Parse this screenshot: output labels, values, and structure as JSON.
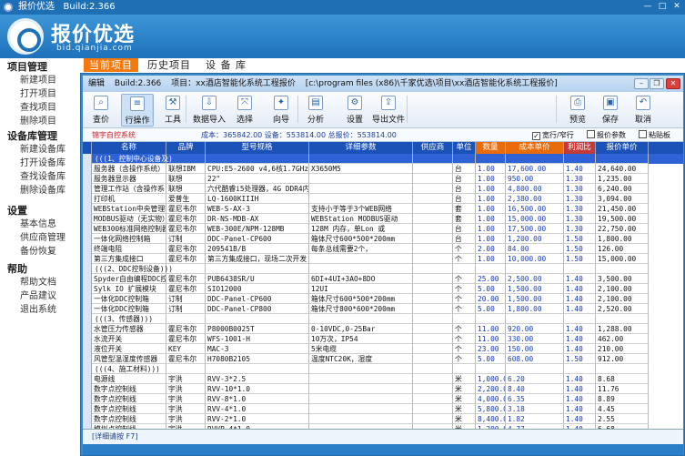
{
  "app": {
    "title": "报价优选",
    "version": "Build:2.366",
    "brand": "报价优选",
    "brand_sub": "bid.qianjia.com"
  },
  "sidebar": [
    {
      "title": "项目管理",
      "items": [
        "新建项目",
        "打开项目",
        "查找项目",
        "删除项目"
      ]
    },
    {
      "title": "设备库管理",
      "items": [
        "新建设备库",
        "打开设备库",
        "查找设备库",
        "删除设备库"
      ]
    },
    {
      "title": "设置",
      "items": [
        "基本信息",
        "供应商管理",
        "备份恢复"
      ]
    },
    {
      "title": "帮助",
      "items": [
        "帮助文档",
        "产品建议",
        "退出系统"
      ]
    }
  ],
  "nav_tabs": [
    "当前项目",
    "历史项目",
    "设 备 库"
  ],
  "window": {
    "menu_edit": "编辑",
    "build": "Build:2.366",
    "project_label": "项目：",
    "project_name": "xx酒店智能化系统工程报价",
    "path": "[c:\\program files (x86)\\千家优选\\项目\\xx酒店智能化系统工程报价]"
  },
  "toolbar": [
    "查价",
    "行操作",
    "工具",
    "数据导入",
    "选择",
    "向导",
    "分析",
    "设置",
    "导出文件",
    "预览",
    "保存",
    "取消"
  ],
  "toolbar_icons": [
    "search-icon",
    "row-icon",
    "tool-icon",
    "import-icon",
    "select-icon",
    "wizard-icon",
    "chart-icon",
    "gear-icon",
    "export-icon",
    "preview-icon",
    "save-icon",
    "cancel-icon"
  ],
  "infobar": {
    "customer": "锦宇自控系统",
    "totals": "成本：365842.00  设备：553814.00  总报价：553814.00",
    "opt_no_tax": "宽行/窄行",
    "opt_params": "报价参数",
    "opt_paste": "粘贴板"
  },
  "grid": {
    "headers": [
      "名称",
      "品牌",
      "型号规格",
      "详细参数",
      "供应商",
      "单位",
      "数量",
      "成本单价",
      "利润比",
      "报价单价"
    ],
    "rows": [
      {
        "g": "(((1、控制中心设备及)",
        "sel": true
      },
      {
        "c": [
          "服务器（含操作系统）",
          "联想IBM",
          "CPU:E5-2600 v4,6核1.7GHz，内存",
          "X3650M5",
          "",
          "台",
          "1.00",
          "17,600.00",
          "1.40",
          "24,640.00"
        ]
      },
      {
        "c": [
          "服务器显示器",
          "联想",
          "22\"",
          "",
          "",
          "台",
          "1.00",
          "950.00",
          "1.30",
          "1,235.00"
        ]
      },
      {
        "c": [
          "管理工作站（含操作系",
          "联想",
          "六代酷睿i5处理器，4G DDR4内存，1T",
          "",
          "",
          "台",
          "1.00",
          "4,800.00",
          "1.30",
          "6,240.00"
        ]
      },
      {
        "c": [
          "打印机",
          "爱普生",
          "LQ-1600KIIIH",
          "",
          "",
          "台",
          "1.00",
          "2,380.00",
          "1.30",
          "3,094.00"
        ]
      },
      {
        "c": [
          "WEBStation中央管理软件",
          "霍尼韦尔",
          "WEB-S-AX-3",
          "支持小于等于3个WEB网络",
          "",
          "套",
          "1.00",
          "16,500.00",
          "1.30",
          "21,450.00"
        ]
      },
      {
        "c": [
          "MODBUS驱动（无实物）",
          "霍尼韦尔",
          "DR-NS-MDB-AX",
          "WEBStation MODBUS驱动",
          "",
          "套",
          "1.00",
          "15,000.00",
          "1.30",
          "19,500.00"
        ]
      },
      {
        "c": [
          "WEB300标准网络控制器",
          "霍尼韦尔",
          "WEB-300E/NPM-128MB",
          "128M 内存，单Lon 或",
          "",
          "台",
          "1.00",
          "17,500.00",
          "1.30",
          "22,750.00"
        ]
      },
      {
        "c": [
          "一体化网络控制箱",
          "订制",
          "DDC-Panel-CP600",
          "箱体尺寸600*500*200mm",
          "",
          "台",
          "1.00",
          "1,200.00",
          "1.50",
          "1,800.00"
        ]
      },
      {
        "c": [
          "终端电阻",
          "霍尼韦尔",
          "209541B/B",
          "每条总线需要2个，",
          "",
          "个",
          "2.00",
          "84.00",
          "1.50",
          "126.00"
        ]
      },
      {
        "c": [
          "第三方集成接口",
          "霍尼韦尔",
          "第三方集成接口，现场二次开发",
          "",
          "",
          "个",
          "1.00",
          "10,000.00",
          "1.50",
          "15,000.00"
        ]
      },
      {
        "g": "(((2、DDC控制设备)))"
      },
      {
        "c": [
          "Spyder自由编程DDC控",
          "霍尼韦尔",
          "PUB6438SR/U",
          "6DI+4UI+3AO+8DO",
          "",
          "个",
          "25.00",
          "2,500.00",
          "1.40",
          "3,500.00"
        ]
      },
      {
        "c": [
          "Sylk IO 扩展模块",
          "霍尼韦尔",
          "SIO12000",
          "12UI",
          "",
          "个",
          "5.00",
          "1,500.00",
          "1.40",
          "2,100.00"
        ]
      },
      {
        "c": [
          "一体化DDC控制箱",
          "订制",
          "DDC-Panel-CP600",
          "箱体尺寸600*500*200mm",
          "",
          "个",
          "20.00",
          "1,500.00",
          "1.40",
          "2,100.00"
        ]
      },
      {
        "c": [
          "一体化DDC控制箱",
          "订制",
          "DDC-Panel-CP800",
          "箱体尺寸800*600*200mm",
          "",
          "个",
          "5.00",
          "1,800.00",
          "1.40",
          "2,520.00"
        ]
      },
      {
        "g": "(((3、传感器)))"
      },
      {
        "c": [
          "水管压力传感器",
          "霍尼韦尔",
          "P8000B0025T",
          "0-10VDC,0-25Bar",
          "",
          "个",
          "11.00",
          "920.00",
          "1.40",
          "1,288.00"
        ]
      },
      {
        "c": [
          "水流开关",
          "霍尼韦尔",
          "WFS-1001-H",
          "10万次，IP54",
          "",
          "个",
          "11.00",
          "330.00",
          "1.40",
          "462.00"
        ]
      },
      {
        "c": [
          "液位开关",
          "KEY",
          "MAC-3",
          "5米电缆",
          "",
          "个",
          "23.00",
          "150.00",
          "1.40",
          "210.00"
        ]
      },
      {
        "c": [
          "风管型温湿度传感器",
          "霍尼韦尔",
          "H7080B2105",
          "温度NTC20K，湿度",
          "",
          "个",
          "5.00",
          "608.00",
          "1.50",
          "912.00"
        ]
      },
      {
        "g": "(((4、施工材料)))"
      },
      {
        "c": [
          "电源线",
          "宇洪",
          "RVV-3*2.5",
          "",
          "",
          "米",
          "1,000.00",
          "6.20",
          "1.40",
          "8.68"
        ]
      },
      {
        "c": [
          "数字点控制线",
          "宇洪",
          "RVV-10*1.0",
          "",
          "",
          "米",
          "2,200.00",
          "8.40",
          "1.40",
          "11.76"
        ]
      },
      {
        "c": [
          "数字点控制线",
          "宇洪",
          "RVV-8*1.0",
          "",
          "",
          "米",
          "4,000.00",
          "6.35",
          "1.40",
          "8.89"
        ]
      },
      {
        "c": [
          "数字点控制线",
          "宇洪",
          "RVV-4*1.0",
          "",
          "",
          "米",
          "5,800.00",
          "3.18",
          "1.40",
          "4.45"
        ]
      },
      {
        "c": [
          "数字点控制线",
          "宇洪",
          "RVV-2*1.0",
          "",
          "",
          "米",
          "8,400.00",
          "1.82",
          "1.40",
          "2.55"
        ]
      },
      {
        "c": [
          "模拟点控制线",
          "宇洪",
          "RVVP-4*1.0",
          "",
          "",
          "米",
          "1,200.00",
          "4.77",
          "1.40",
          "6.68"
        ]
      },
      {
        "c": [
          "模拟点控制线",
          "宇洪",
          "RVVP-2*1.0",
          "",
          "",
          "米",
          "2,800.00",
          "2.80",
          "1.40",
          "3.92"
        ]
      }
    ]
  },
  "status": "[详细请按 F7]"
}
